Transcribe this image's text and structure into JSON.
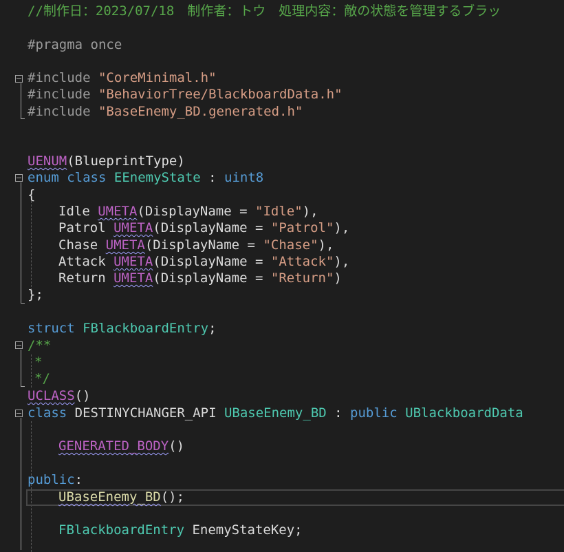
{
  "code": {
    "l1": "//制作日：2023/07/18　制作者：トウ　処理内容：敵の状態を管理するブラッ",
    "l2": "#pragma once",
    "l3a": "#include ",
    "l3b": "\"CoreMinimal.h\"",
    "l4a": "#include ",
    "l4b": "\"BehaviorTree/BlackboardData.h\"",
    "l5a": "#include ",
    "l5b": "\"BaseEnemy_BD.generated.h\"",
    "l6a": "UENUM",
    "l6b": "(BlueprintType)",
    "l7a": "enum",
    "l7b": " ",
    "l7c": "class",
    "l7d": " ",
    "l7e": "EEnemyState",
    "l7f": " : ",
    "l7g": "uint8",
    "l8": "{",
    "l9a": "Idle ",
    "l9b": "UMETA",
    "l9c": "(DisplayName = ",
    "l9d": "\"Idle\"",
    "l9e": "),",
    "l10a": "Patrol ",
    "l10b": "UMETA",
    "l10c": "(DisplayName = ",
    "l10d": "\"Patrol\"",
    "l10e": "),",
    "l11a": "Chase ",
    "l11b": "UMETA",
    "l11c": "(DisplayName = ",
    "l11d": "\"Chase\"",
    "l11e": "),",
    "l12a": "Attack ",
    "l12b": "UMETA",
    "l12c": "(DisplayName = ",
    "l12d": "\"Attack\"",
    "l12e": "),",
    "l13a": "Return ",
    "l13b": "UMETA",
    "l13c": "(DisplayName = ",
    "l13d": "\"Return\"",
    "l13e": ")",
    "l14": "};",
    "l15a": "struct",
    "l15b": " ",
    "l15c": "FBlackboardEntry",
    "l15d": ";",
    "l16": "/**",
    "l17": "*",
    "l18": "*/",
    "l19a": "UCLASS",
    "l19b": "()",
    "l20a": "class",
    "l20b": " DESTINYCHANGER_API ",
    "l20c": "UBaseEnemy_BD",
    "l20d": " : ",
    "l20e": "public",
    "l20f": " ",
    "l20g": "UBlackboardData",
    "l21a": "GENERATED_BODY",
    "l21b": "()",
    "l22a": "public",
    "l22b": ":",
    "l23a": "UBaseEnemy_BD",
    "l23b": "();",
    "l24a": "FBlackboardEntry",
    "l24b": " EnemyStateKey;"
  }
}
